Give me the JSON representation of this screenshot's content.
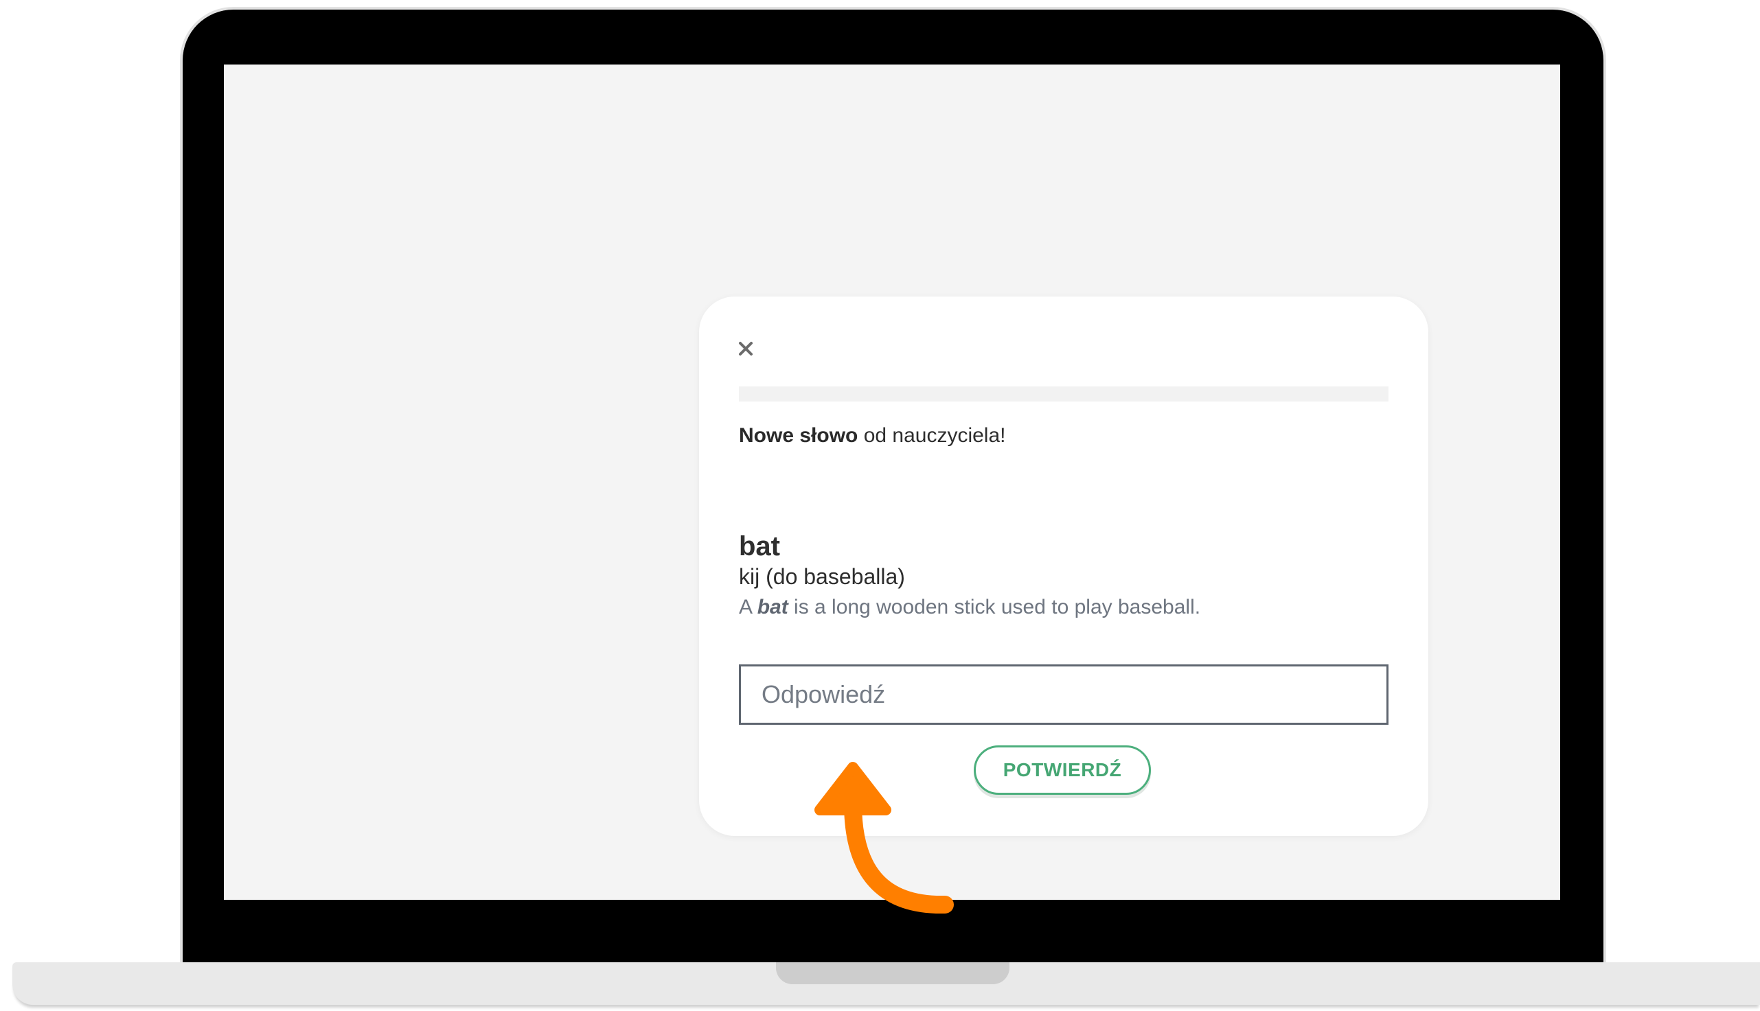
{
  "modal": {
    "close_icon": "close-icon",
    "progress_fraction": 0,
    "notice_bold": "Nowe słowo",
    "notice_rest": " od nauczyciela!",
    "word": "bat",
    "translation": "kij (do baseballa)",
    "example_prefix": "A ",
    "example_word": "bat",
    "example_suffix": " is a long wooden stick used to play baseball.",
    "answer": {
      "placeholder": "Odpowiedź",
      "value": ""
    },
    "confirm_label": "POTWIERDŹ"
  },
  "colors": {
    "accent_green": "#4caf7d",
    "annotation_orange": "#ff7f00",
    "screen_bg": "#f4f4f4"
  }
}
